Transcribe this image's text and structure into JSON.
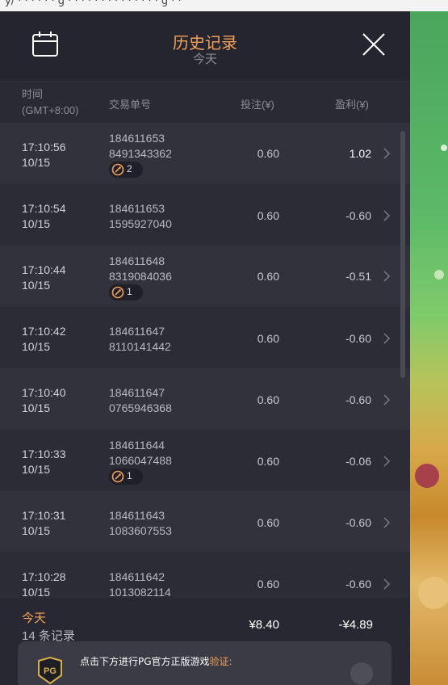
{
  "browser": {
    "cut_text": "y/ · · · · · · g · · · · · · · · · · · · · · g · ·"
  },
  "header": {
    "title": "历史记录",
    "subtitle": "今天"
  },
  "columns": {
    "time": "时间",
    "timezone": "(GMT+8:00)",
    "order": "交易单号",
    "bet": "投注(¥)",
    "profit": "盈利(¥)"
  },
  "rows": [
    {
      "time": "17:10:56",
      "date": "10/15",
      "order_line1": "184611653",
      "order_line2": "8491343362",
      "badge": "2",
      "bet": "0.60",
      "profit": "1.02",
      "profit_color": "#ffffff"
    },
    {
      "time": "17:10:54",
      "date": "10/15",
      "order_line1": "184611653",
      "order_line2": "1595927040",
      "badge": "",
      "bet": "0.60",
      "profit": "-0.60",
      "profit_color": "#c9c9d1"
    },
    {
      "time": "17:10:44",
      "date": "10/15",
      "order_line1": "184611648",
      "order_line2": "8319084036",
      "badge": "1",
      "bet": "0.60",
      "profit": "-0.51",
      "profit_color": "#c9c9d1"
    },
    {
      "time": "17:10:42",
      "date": "10/15",
      "order_line1": "184611647",
      "order_line2": "8110141442",
      "badge": "",
      "bet": "0.60",
      "profit": "-0.60",
      "profit_color": "#c9c9d1"
    },
    {
      "time": "17:10:40",
      "date": "10/15",
      "order_line1": "184611647",
      "order_line2": "0765946368",
      "badge": "",
      "bet": "0.60",
      "profit": "-0.60",
      "profit_color": "#c9c9d1"
    },
    {
      "time": "17:10:33",
      "date": "10/15",
      "order_line1": "184611644",
      "order_line2": "1066047488",
      "badge": "1",
      "bet": "0.60",
      "profit": "-0.06",
      "profit_color": "#c9c9d1"
    },
    {
      "time": "17:10:31",
      "date": "10/15",
      "order_line1": "184611643",
      "order_line2": "1083607553",
      "badge": "",
      "bet": "0.60",
      "profit": "-0.60",
      "profit_color": "#c9c9d1"
    },
    {
      "time": "17:10:28",
      "date": "10/15",
      "order_line1": "184611642",
      "order_line2": "1013082114",
      "badge": "",
      "bet": "0.60",
      "profit": "-0.60",
      "profit_color": "#c9c9d1"
    }
  ],
  "footer": {
    "today": "今天",
    "count": "14 条记录",
    "total_bet": "¥8.40",
    "total_profit": "-¥4.89"
  },
  "verify": {
    "text": "点击下方进行PG官方正版游戏",
    "accent": "验证:",
    "logo": "PG"
  },
  "colors": {
    "accent": "#f3a15a",
    "panel": "#2c2c36",
    "row_alt": "#32323d"
  },
  "icons": {
    "calendar": "calendar-icon",
    "close": "close-icon",
    "chevron": "chevron-right-icon",
    "free_spin": "free-spin-icon"
  }
}
